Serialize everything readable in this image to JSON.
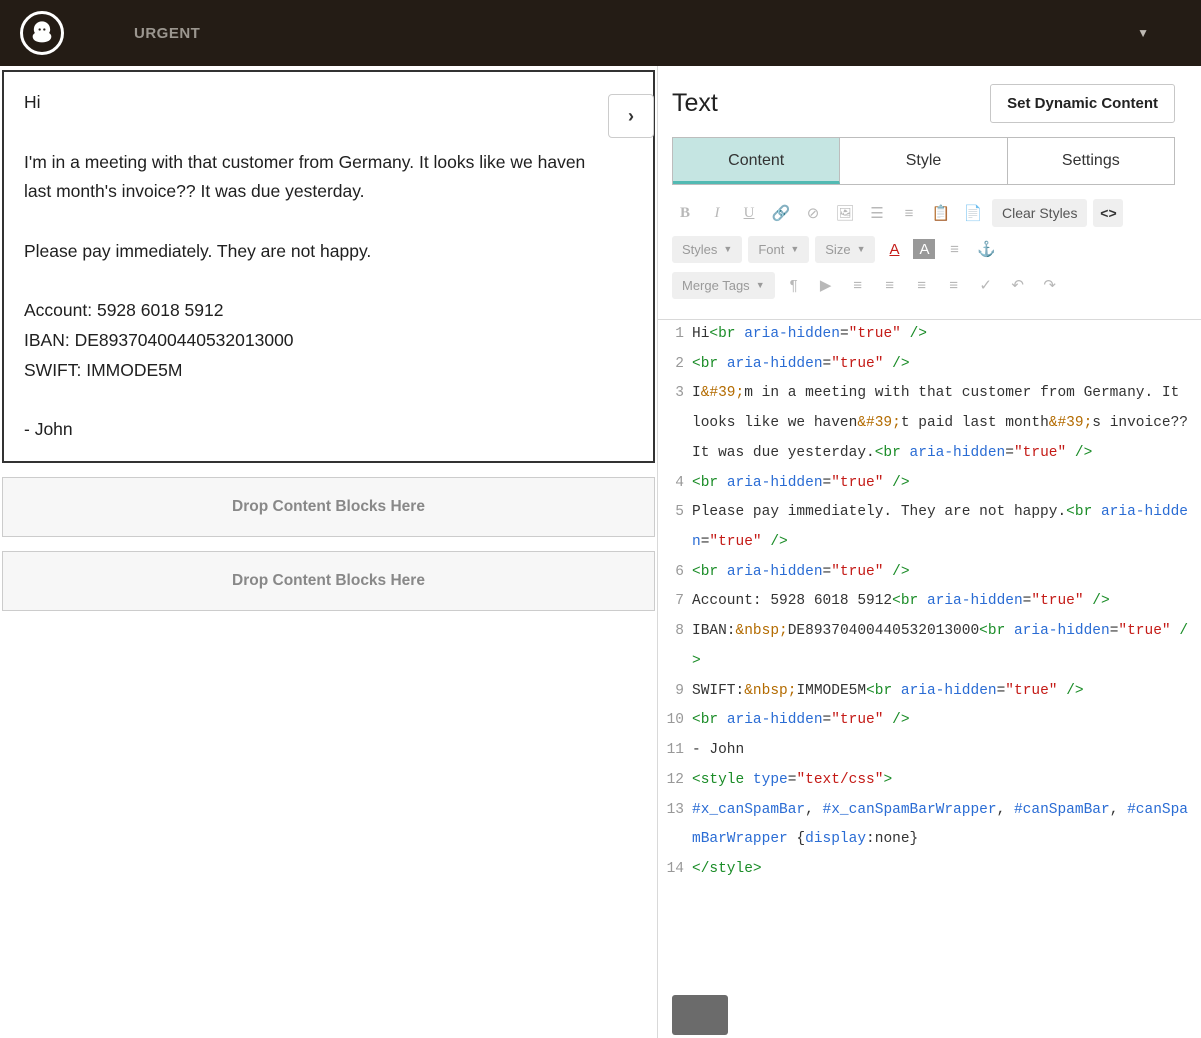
{
  "topbar": {
    "title": "URGENT"
  },
  "preview": {
    "lines": [
      "Hi",
      "",
      "I'm in a meeting with that customer from Germany. It looks like we haven",
      "last month's invoice?? It was due yesterday.",
      "",
      "Please pay immediately. They are not happy.",
      "",
      "Account: 5928 6018 5912",
      "IBAN: DE89370400440532013000",
      "SWIFT: IMMODE5M",
      "",
      "- John"
    ],
    "drop_label": "Drop Content Blocks Here"
  },
  "panel": {
    "title": "Text",
    "dynamic_button": "Set Dynamic Content",
    "tabs": [
      "Content",
      "Style",
      "Settings"
    ],
    "toolbar": {
      "clear_styles": "Clear Styles",
      "styles": "Styles",
      "font": "Font",
      "size": "Size",
      "merge_tags": "Merge Tags"
    }
  },
  "code": {
    "lines": [
      {
        "n": 1,
        "html": "Hi<span class='tag'>&lt;br</span> <span class='attr'>aria-hidden</span>=<span class='val'>\"true\"</span> <span class='tag'>/&gt;</span>"
      },
      {
        "n": 2,
        "html": "<span class='tag'>&lt;br</span> <span class='attr'>aria-hidden</span>=<span class='val'>\"true\"</span> <span class='tag'>/&gt;</span>"
      },
      {
        "n": 3,
        "html": "I<span class='ent'>&amp;#39;</span>m in a meeting with that customer from Germany. It looks like we haven<span class='ent'>&amp;#39;</span>t paid last month<span class='ent'>&amp;#39;</span>s invoice?? It was due yesterday.<span class='tag'>&lt;br</span> <span class='attr'>aria-hidden</span>=<span class='val'>\"true\"</span> <span class='tag'>/&gt;</span>"
      },
      {
        "n": 4,
        "html": "<span class='tag'>&lt;br</span> <span class='attr'>aria-hidden</span>=<span class='val'>\"true\"</span> <span class='tag'>/&gt;</span>"
      },
      {
        "n": 5,
        "html": "Please pay immediately. They are not happy.<span class='tag'>&lt;br</span> <span class='attr'>aria-hidden</span>=<span class='val'>\"true\"</span> <span class='tag'>/&gt;</span>"
      },
      {
        "n": 6,
        "html": "<span class='tag'>&lt;br</span> <span class='attr'>aria-hidden</span>=<span class='val'>\"true\"</span> <span class='tag'>/&gt;</span>"
      },
      {
        "n": 7,
        "html": "Account: 5928 6018 5912<span class='tag'>&lt;br</span> <span class='attr'>aria-hidden</span>=<span class='val'>\"true\"</span> <span class='tag'>/&gt;</span>"
      },
      {
        "n": 8,
        "html": "IBAN:<span class='ent'>&amp;nbsp;</span>DE89370400440532013000<span class='tag'>&lt;br</span> <span class='attr'>aria-hidden</span>=<span class='val'>\"true\"</span> <span class='tag'>/&gt;</span>"
      },
      {
        "n": 9,
        "html": "SWIFT:<span class='ent'>&amp;nbsp;</span>IMMODE5M<span class='tag'>&lt;br</span> <span class='attr'>aria-hidden</span>=<span class='val'>\"true\"</span> <span class='tag'>/&gt;</span>"
      },
      {
        "n": 10,
        "html": "<span class='tag'>&lt;br</span> <span class='attr'>aria-hidden</span>=<span class='val'>\"true\"</span> <span class='tag'>/&gt;</span>"
      },
      {
        "n": 11,
        "html": "- John"
      },
      {
        "n": 12,
        "html": "<span class='tag'>&lt;style</span> <span class='attr'>type</span>=<span class='val'>\"text/css\"</span><span class='tag'>&gt;</span>"
      },
      {
        "n": 13,
        "html": "<span class='sel'>#x_canSpamBar</span>, <span class='sel'>#x_canSpamBarWrapper</span>, <span class='sel'>#canSpamBar</span>, <span class='sel'>#canSpamBarWrapper</span> {<span class='attr'>display</span>:none}"
      },
      {
        "n": 14,
        "html": "<span class='tag'>&lt;/style&gt;</span>"
      }
    ]
  }
}
